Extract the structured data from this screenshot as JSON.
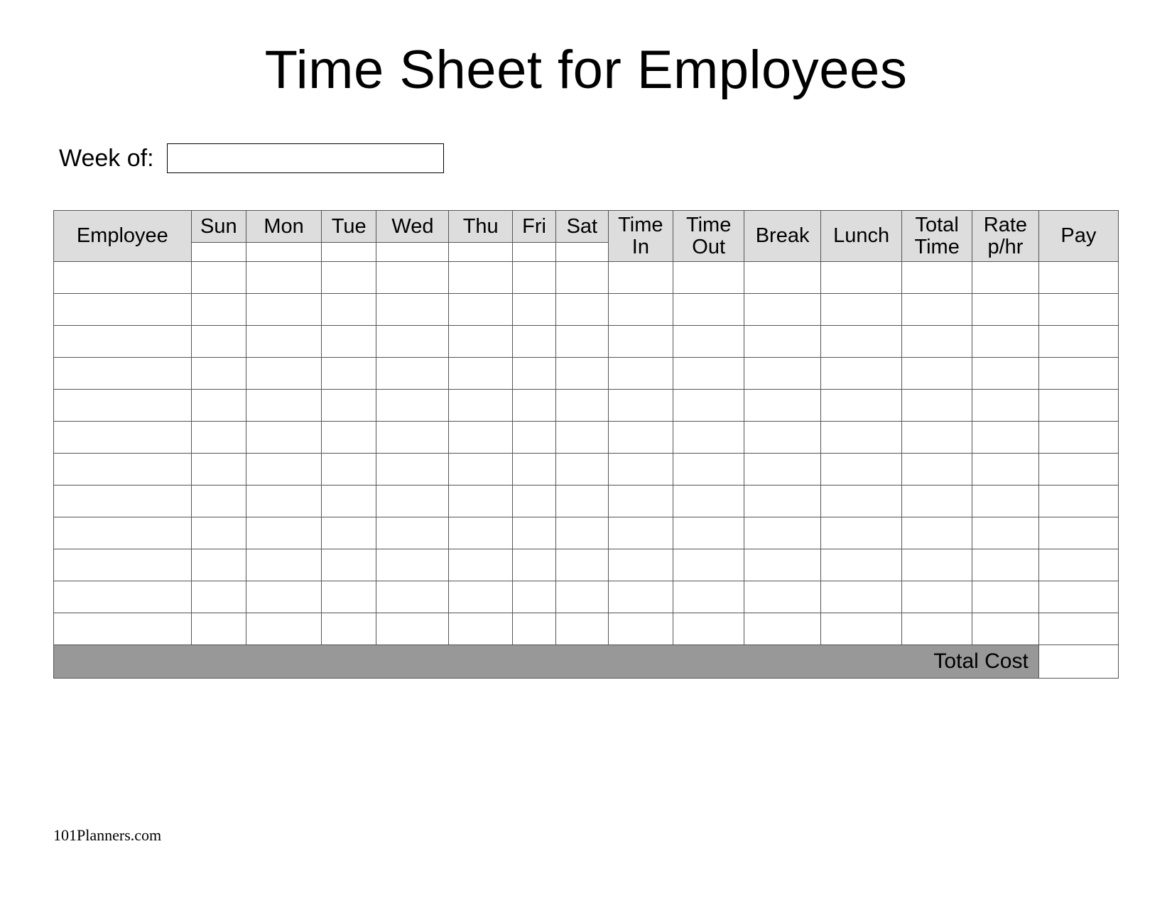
{
  "title": "Time Sheet for Employees",
  "week_of_label": "Week of:",
  "week_of_value": "",
  "headers": {
    "employee": "Employee",
    "sun": "Sun",
    "mon": "Mon",
    "tue": "Tue",
    "wed": "Wed",
    "thu": "Thu",
    "fri": "Fri",
    "sat": "Sat",
    "time_in_1": "Time",
    "time_in_2": "In",
    "time_out_1": "Time",
    "time_out_2": "Out",
    "break": "Break",
    "lunch": "Lunch",
    "total_time_1": "Total",
    "total_time_2": "Time",
    "rate_1": "Rate",
    "rate_2": "p/hr",
    "pay": "Pay"
  },
  "total_cost_label": "Total Cost",
  "total_cost_value": "",
  "footer": "101Planners.com",
  "row_count": 12
}
